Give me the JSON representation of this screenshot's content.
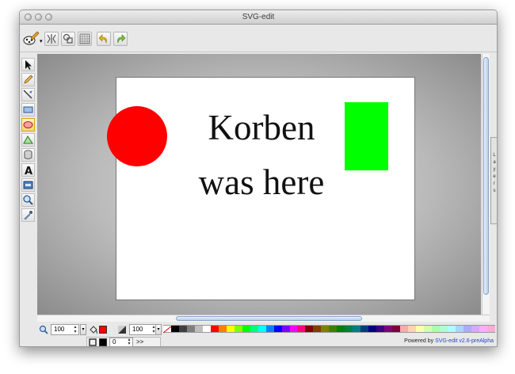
{
  "window": {
    "title": "SVG-edit"
  },
  "canvas_text": {
    "line1": "Korben",
    "line2": "was here"
  },
  "shapes": {
    "circle_fill": "#ff0000",
    "rect_fill": "#00ff00",
    "text_fill": "#111111"
  },
  "layers_tab": {
    "label": [
      "L",
      "a",
      "y",
      "e",
      "r",
      "s"
    ]
  },
  "zoom": {
    "value": "100"
  },
  "opacity": {
    "value": "100"
  },
  "stroke_width": {
    "value": "0"
  },
  "fill_color": "#ff0000",
  "stroke_color": "#000000",
  "more_label": ">>",
  "footer": {
    "prefix": "Powered by ",
    "link": "SVG-edit v2.6-preAlpha"
  },
  "palette": [
    "#000000",
    "#3f3f3f",
    "#7f7f7f",
    "#bfbfbf",
    "#ffffff",
    "#ff0000",
    "#ff7f00",
    "#ffff00",
    "#7fff00",
    "#00ff00",
    "#00ff7f",
    "#00ffff",
    "#007fff",
    "#0000ff",
    "#7f00ff",
    "#ff00ff",
    "#ff007f",
    "#7f0000",
    "#7f3f00",
    "#7f7f00",
    "#3f7f00",
    "#007f00",
    "#007f3f",
    "#007f7f",
    "#003f7f",
    "#00007f",
    "#3f007f",
    "#7f007f",
    "#7f003f",
    "#ffaaaa",
    "#ffd4aa",
    "#ffffaa",
    "#d4ffaa",
    "#aaffaa",
    "#aaffd4",
    "#aaffff",
    "#aad4ff",
    "#aaaaff",
    "#d4aaff",
    "#ffaaff",
    "#ffaad4"
  ]
}
